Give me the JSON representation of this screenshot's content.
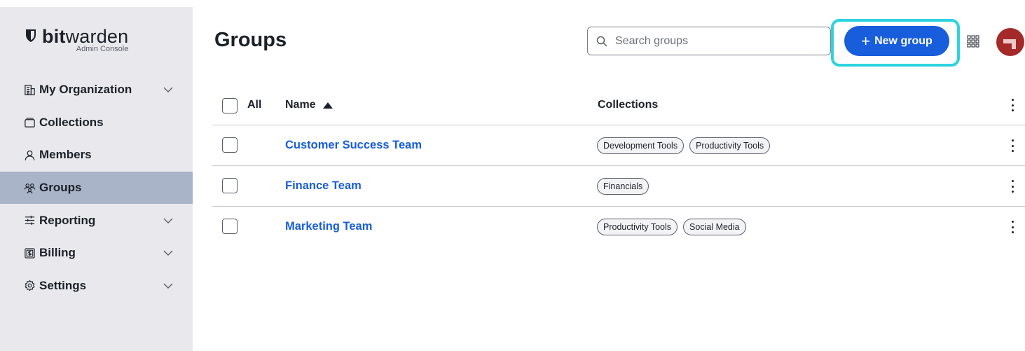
{
  "brand": {
    "name_bold": "bit",
    "name_rest": "warden",
    "subtitle": "Admin Console"
  },
  "sidebar": {
    "items": [
      {
        "label": "My Organization",
        "icon": "building-icon",
        "expandable": true,
        "active": false
      },
      {
        "label": "Collections",
        "icon": "collection-icon",
        "expandable": false,
        "active": false
      },
      {
        "label": "Members",
        "icon": "user-icon",
        "expandable": false,
        "active": false
      },
      {
        "label": "Groups",
        "icon": "users-icon",
        "expandable": false,
        "active": true
      },
      {
        "label": "Reporting",
        "icon": "sliders-icon",
        "expandable": true,
        "active": false
      },
      {
        "label": "Billing",
        "icon": "billing-icon",
        "expandable": true,
        "active": false
      },
      {
        "label": "Settings",
        "icon": "cog-icon",
        "expandable": true,
        "active": false
      }
    ]
  },
  "header": {
    "title": "Groups",
    "search_placeholder": "Search groups",
    "new_group_label": "New group"
  },
  "table": {
    "all_label": "All",
    "col_name": "Name",
    "col_collections": "Collections",
    "rows": [
      {
        "name": "Customer Success Team",
        "collections": [
          "Development Tools",
          "Productivity Tools"
        ]
      },
      {
        "name": "Finance Team",
        "collections": [
          "Financials"
        ]
      },
      {
        "name": "Marketing Team",
        "collections": [
          "Productivity Tools",
          "Social Media"
        ]
      }
    ]
  },
  "colors": {
    "accent": "#175ddc",
    "sidebar_bg": "#e9e9ed",
    "active_nav": "#aab4c8",
    "highlight": "#2cd3df",
    "avatar": "#a42a2a"
  }
}
